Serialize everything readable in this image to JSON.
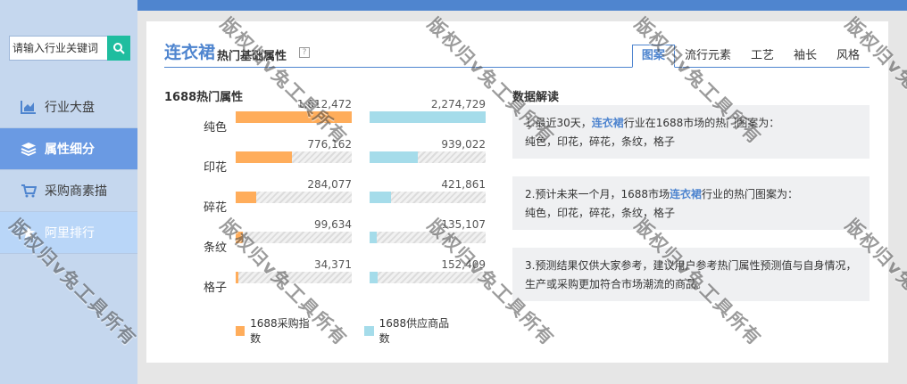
{
  "sidebar": {
    "search_placeholder": "请输入行业关键词",
    "items": [
      {
        "label": "行业大盘",
        "icon": "chart-icon"
      },
      {
        "label": "属性细分",
        "icon": "layers-icon"
      },
      {
        "label": "采购商素描",
        "icon": "cart-icon"
      },
      {
        "label": "阿里排行",
        "icon": "star-icon"
      }
    ]
  },
  "header": {
    "category": "连衣裙",
    "subtitle": "热门基础属性",
    "help": "?"
  },
  "tabs": [
    "图案",
    "流行元素",
    "工艺",
    "袖长",
    "风格"
  ],
  "chart_data": {
    "type": "bar",
    "title": "1688热门属性",
    "categories": [
      "纯色",
      "印花",
      "碎花",
      "条纹",
      "格子"
    ],
    "series": [
      {
        "name": "1688采购指数",
        "color": "#ffad5b",
        "values": [
          1612472,
          776162,
          284077,
          99634,
          34371
        ],
        "labels": [
          "1,612,472",
          "776,162",
          "284,077",
          "99,634",
          "34,371"
        ]
      },
      {
        "name": "1688供应商品数",
        "color": "#a5dcea",
        "values": [
          2274729,
          939022,
          421861,
          135107,
          152409
        ],
        "labels": [
          "2,274,729",
          "939,022",
          "421,861",
          "135,107",
          "152,409"
        ]
      }
    ]
  },
  "insights": {
    "title": "数据解读",
    "card1": {
      "pre": "1.最近30天，",
      "hl": "连衣裙",
      "post": "行业在1688市场的热门图案为：",
      "line2": "纯色，印花，碎花，条纹，格子"
    },
    "card2": {
      "pre": "2.预计未来一个月，1688市场",
      "hl": "连衣裙",
      "post": "行业的热门图案为：",
      "line2": "纯色，印花，碎花，条纹，格子"
    },
    "card3": {
      "text": "3.预测结果仅供大家参考，建议用户参考热门属性预测值与自身情况，生产或采购更加符合市场潮流的商品。"
    }
  },
  "watermark": "版权归v兔工具所有",
  "colors": {
    "accent": "#4f85cf",
    "search_button": "#1fbd9f",
    "nav_active": "#6a9ae3",
    "sidebar_bg": "#c5d7ee"
  }
}
